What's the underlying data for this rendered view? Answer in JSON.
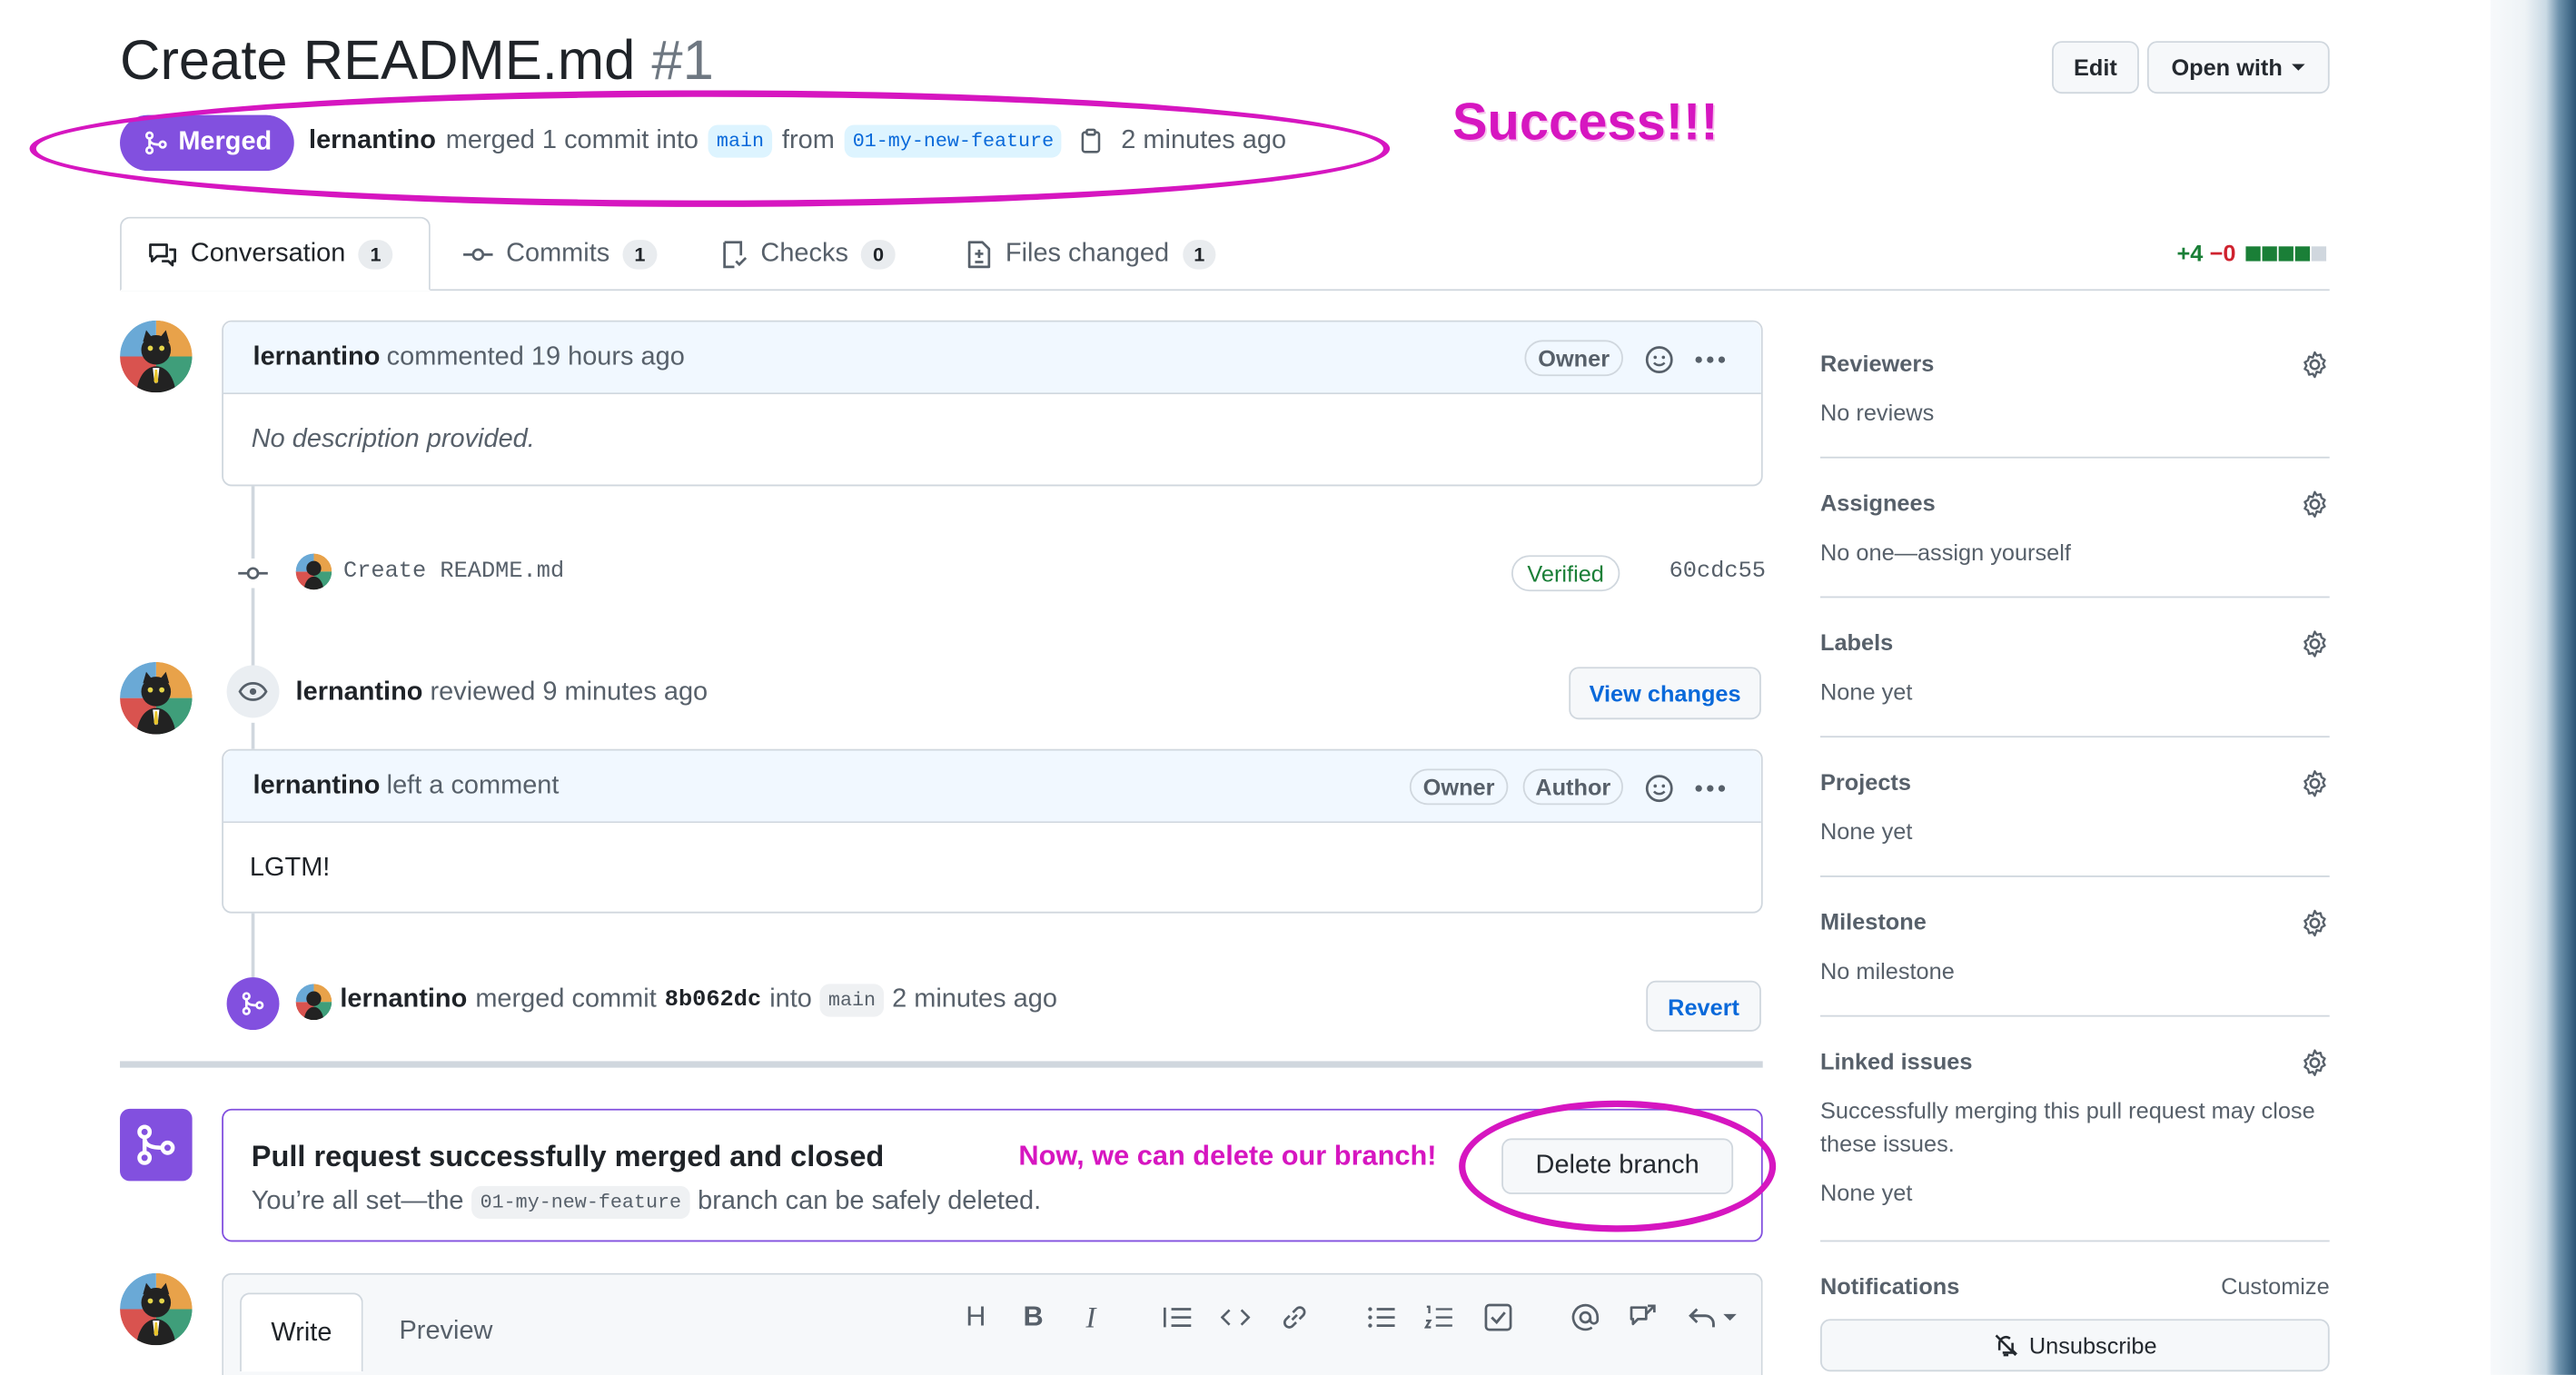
{
  "header": {
    "title": "Create README.md",
    "number": "#1",
    "edit_label": "Edit",
    "open_with_label": "Open with"
  },
  "status": {
    "badge_label": "Merged",
    "user": "lernantino",
    "merged_text": "merged 1 commit into",
    "base_branch": "main",
    "from_text": "from",
    "head_branch": "01-my-new-feature",
    "time": "2 minutes ago"
  },
  "annotations": {
    "success": "Success!!!",
    "delete_hint": "Now, we can delete our branch!",
    "color": "#d616c0"
  },
  "tabs": [
    {
      "label": "Conversation",
      "count": "1",
      "icon": "comment-discussion-icon"
    },
    {
      "label": "Commits",
      "count": "1",
      "icon": "git-commit-icon"
    },
    {
      "label": "Checks",
      "count": "0",
      "icon": "checklist-icon"
    },
    {
      "label": "Files changed",
      "count": "1",
      "icon": "file-diff-icon"
    }
  ],
  "diffstat": {
    "additions": "+4",
    "deletions": "−0",
    "add_color": "#1a7f37",
    "del_color": "#cf222e",
    "bar_filled": 4,
    "bar_total": 5
  },
  "timeline": {
    "comment1": {
      "user": "lernantino",
      "action": "commented 19 hours ago",
      "badge": "Owner",
      "body": "No description provided."
    },
    "commit": {
      "message": "Create README.md",
      "verified": "Verified",
      "sha": "60cdc55"
    },
    "review": {
      "user": "lernantino",
      "action": "reviewed 9 minutes ago",
      "view_changes": "View changes"
    },
    "comment2": {
      "user": "lernantino",
      "action": "left a comment",
      "badge_owner": "Owner",
      "badge_author": "Author",
      "body": "LGTM!"
    },
    "merge_event": {
      "user": "lernantino",
      "merged_commit_text": "merged commit",
      "sha": "8b062dc",
      "into_text": "into",
      "branch": "main",
      "time": "2 minutes ago",
      "revert": "Revert"
    }
  },
  "merge_box": {
    "title": "Pull request successfully merged and closed",
    "pre_text": "You’re all set—the",
    "branch": "01-my-new-feature",
    "post_text": "branch can be safely deleted.",
    "delete_label": "Delete branch"
  },
  "composer": {
    "write_tab": "Write",
    "preview_tab": "Preview",
    "tools": [
      "heading-icon",
      "bold-icon",
      "italic-icon",
      "quote-icon",
      "code-icon",
      "link-icon",
      "unordered-list-icon",
      "ordered-list-icon",
      "tasklist-icon",
      "mention-icon",
      "cross-reference-icon",
      "reply-icon"
    ]
  },
  "sidebar": {
    "sections": [
      {
        "title": "Reviewers",
        "value": "No reviews"
      },
      {
        "title": "Assignees",
        "value": "No one—assign yourself"
      },
      {
        "title": "Labels",
        "value": "None yet"
      },
      {
        "title": "Projects",
        "value": "None yet"
      },
      {
        "title": "Milestone",
        "value": "No milestone"
      },
      {
        "title": "Linked issues",
        "value": "Successfully merging this pull request may close these issues.",
        "value2": "None yet"
      }
    ],
    "notifications": {
      "title": "Notifications",
      "customize": "Customize",
      "unsubscribe": "Unsubscribe"
    }
  }
}
